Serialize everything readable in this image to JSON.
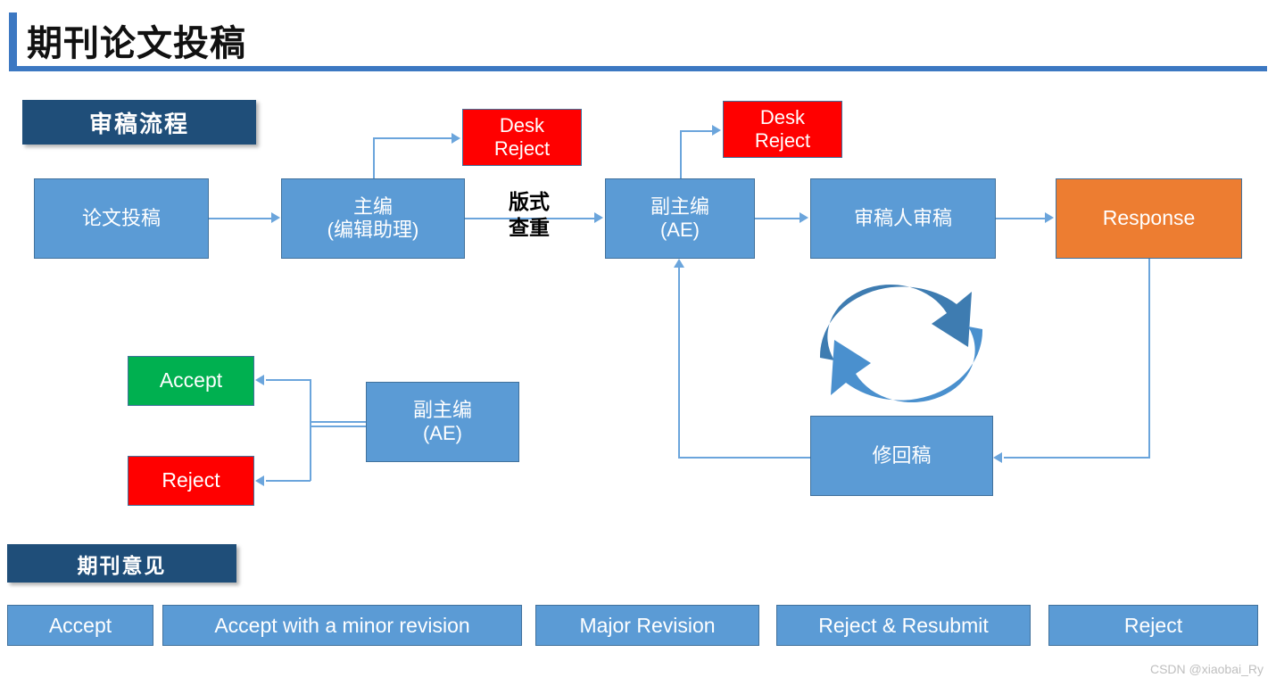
{
  "page": {
    "title": "期刊论文投稿",
    "watermark": "CSDN @xiaobai_Ry",
    "accent_blue": "#3C78C2",
    "banner_navy": "#1F4E79",
    "node_blue": "#5B9BD5",
    "node_orange": "#ED7D31",
    "node_red": "#FF0000",
    "node_green": "#00B050",
    "connector_blue": "#6BA5DC"
  },
  "sections": {
    "flow_banner": "审稿流程",
    "opinion_banner": "期刊意见"
  },
  "flow": {
    "nodes": [
      {
        "id": "submit",
        "label": "论文投稿",
        "color": "#5B9BD5"
      },
      {
        "id": "eic",
        "label": "主编\n(编辑助理)",
        "color": "#5B9BD5"
      },
      {
        "id": "desk1",
        "label": "Desk\nReject",
        "color": "#FF0000"
      },
      {
        "id": "ae1",
        "label": "副主编\n(AE)",
        "color": "#5B9BD5"
      },
      {
        "id": "desk2",
        "label": "Desk\nReject",
        "color": "#FF0000"
      },
      {
        "id": "review",
        "label": "审稿人审稿",
        "color": "#5B9BD5"
      },
      {
        "id": "response",
        "label": "Response",
        "color": "#ED7D31"
      },
      {
        "id": "revised",
        "label": "修回稿",
        "color": "#5B9BD5"
      },
      {
        "id": "ae2",
        "label": "副主编\n(AE)",
        "color": "#5B9BD5"
      },
      {
        "id": "accept",
        "label": "Accept",
        "color": "#00B050"
      },
      {
        "id": "reject",
        "label": "Reject",
        "color": "#FF0000"
      }
    ],
    "edge_label_format": "版式\n查重"
  },
  "opinions": {
    "options": [
      "Accept",
      "Accept with a minor revision",
      "Major Revision",
      "Reject & Resubmit",
      "Reject"
    ]
  }
}
